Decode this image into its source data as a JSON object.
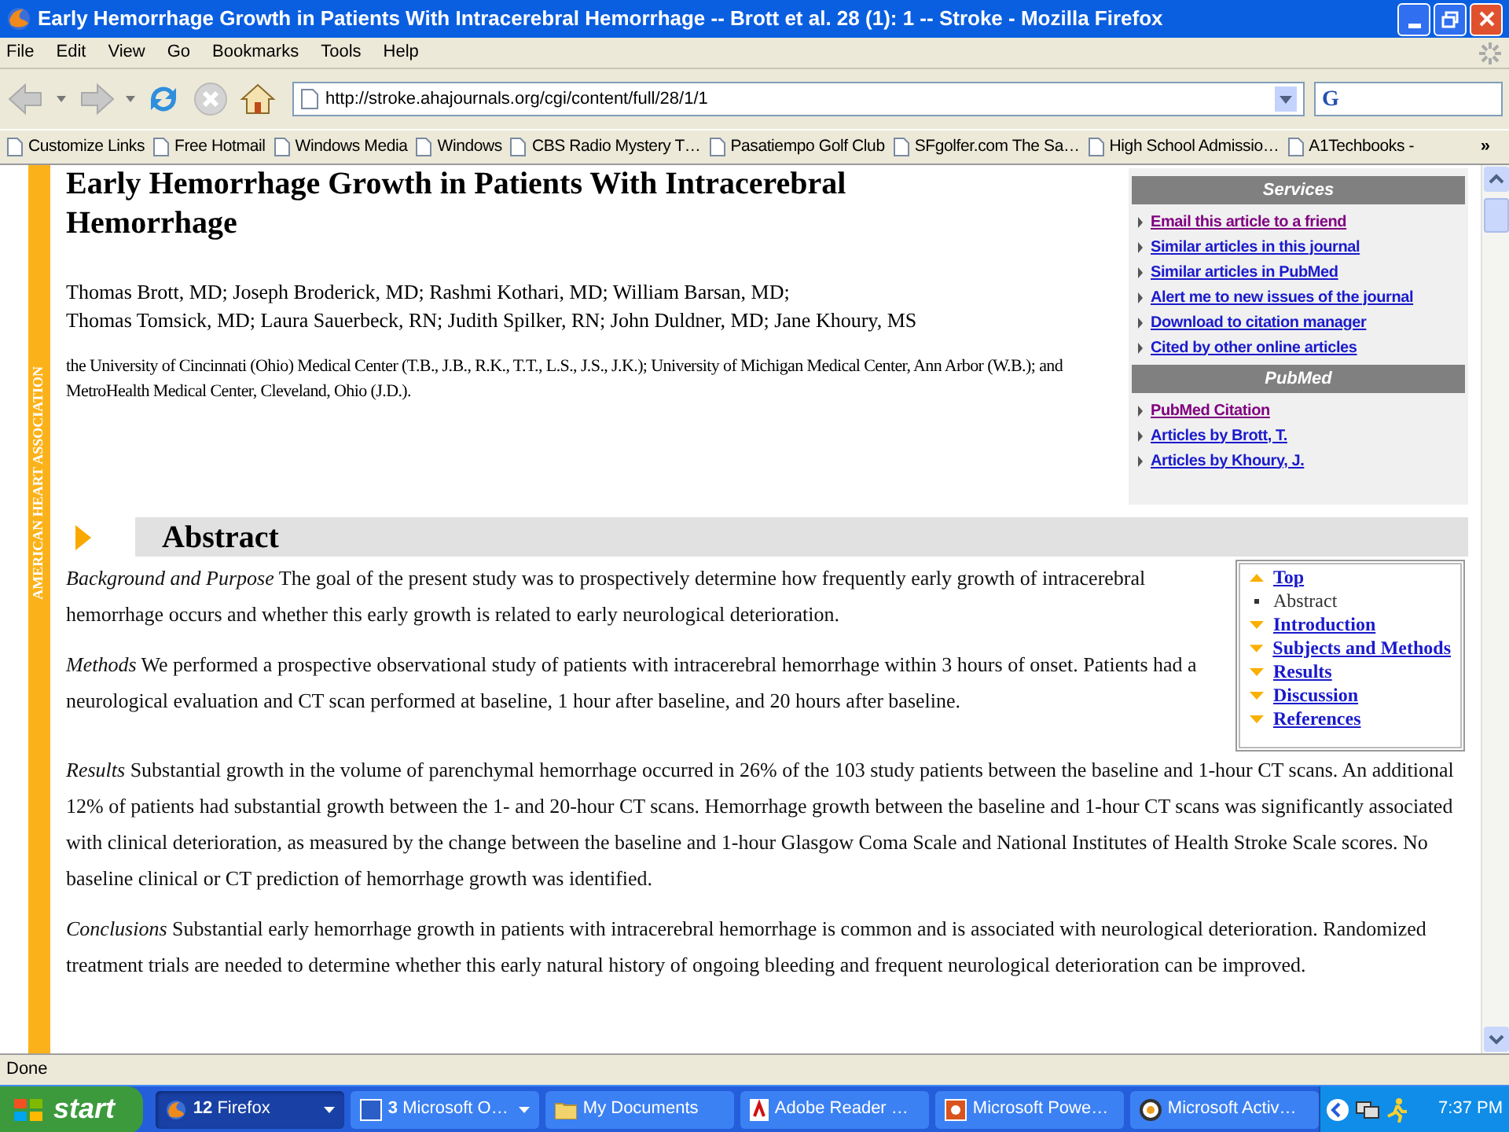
{
  "window": {
    "title": "Early Hemorrhage Growth in Patients With Intracerebral Hemorrhage -- Brott et al. 28 (1): 1 -- Stroke - Mozilla Firefox"
  },
  "menu": [
    "File",
    "Edit",
    "View",
    "Go",
    "Bookmarks",
    "Tools",
    "Help"
  ],
  "toolbar": {
    "url": "http://stroke.ahajournals.org/cgi/content/full/28/1/1",
    "search_logo": "G"
  },
  "bookmarks": [
    "Customize Links",
    "Free Hotmail",
    "Windows Media",
    "Windows",
    "CBS Radio Mystery T…",
    "Pasatiempo Golf Club",
    "SFgolfer.com The Sa…",
    "High School Admissio…",
    "A1Techbooks -"
  ],
  "bookmarks_more": "»",
  "article": {
    "sidebar_label": "AMERICAN HEART ASSOCIATION",
    "title": "Early Hemorrhage Growth in Patients With Intracerebral Hemorrhage",
    "authors": [
      "Thomas Brott, MD; Joseph Broderick, MD; Rashmi Kothari, MD; William Barsan, MD;",
      "Thomas Tomsick, MD; Laura Sauerbeck, RN; Judith Spilker, RN; John Duldner, MD; Jane Khoury, MS"
    ],
    "affiliation": "the University of Cincinnati (Ohio) Medical Center (T.B., J.B., R.K., T.T., L.S., J.S., J.K.); University of Michigan Medical Center, Ann Arbor (W.B.); and MetroHealth Medical Center, Cleveland, Ohio (J.D.).",
    "section_heading": "Abstract",
    "paragraphs": [
      "*Background and Purpose* The goal of the present study was to prospectively determine how frequently early growth of intracerebral hemorrhage occurs and whether this early growth is related to early neurological deterioration.",
      "*Methods* We performed a prospective observational study of patients with intracerebral hemorrhage within 3 hours of onset. Patients had a neurological evaluation and CT scan performed at baseline, 1 hour after baseline, and 20 hours after baseline.",
      "*Results* Substantial growth in the volume of parenchymal hemorrhage occurred in 26% of the 103 study patients between the baseline and 1-hour CT scans. An additional 12% of patients had substantial growth between the 1- and 20-hour CT scans. Hemorrhage growth between the baseline and 1-hour CT scans was significantly associated with clinical deterioration, as measured by the change between the baseline and 1-hour Glasgow Coma Scale and National Institutes of Health Stroke Scale scores. No baseline clinical or CT prediction of hemorrhage growth was identified.",
      "*Conclusions* Substantial early hemorrhage growth in patients with intracerebral hemorrhage is common and is associated with neurological deterioration. Randomized treatment trials are needed to determine whether this early natural history of ongoing bleeding and frequent neurological deterioration can be improved."
    ]
  },
  "services": {
    "heading": "Services",
    "links": [
      {
        "label": "Email this article to a friend",
        "visited": true
      },
      {
        "label": "Similar articles in this journal",
        "visited": false
      },
      {
        "label": "Similar articles in PubMed",
        "visited": false
      },
      {
        "label": "Alert me to new issues of the journal",
        "visited": false
      },
      {
        "label": "Download to citation manager",
        "visited": false
      },
      {
        "label": "Cited by other online articles",
        "visited": false
      }
    ]
  },
  "pubmed": {
    "heading": "PubMed",
    "links": [
      {
        "label": "PubMed Citation",
        "visited": true
      },
      {
        "label": "Articles by Brott, T.",
        "visited": false
      },
      {
        "label": "Articles by Khoury, J.",
        "visited": false
      }
    ]
  },
  "toc": [
    {
      "label": "Top",
      "kind": "up"
    },
    {
      "label": "Abstract",
      "kind": "current"
    },
    {
      "label": "Introduction",
      "kind": "down"
    },
    {
      "label": "Subjects and Methods",
      "kind": "down"
    },
    {
      "label": "Results",
      "kind": "down"
    },
    {
      "label": "Discussion",
      "kind": "down"
    },
    {
      "label": "References",
      "kind": "down"
    }
  ],
  "status_bar": "Done",
  "taskbar": {
    "start": "start",
    "tasks": [
      {
        "label": "**12** Firefox",
        "selected": true,
        "group": true
      },
      {
        "label": "**3** Microsoft O…",
        "selected": false,
        "group": true
      },
      {
        "label": "My Documents",
        "selected": false,
        "group": false
      },
      {
        "label": "Adobe Reader …",
        "selected": false,
        "group": false
      },
      {
        "label": "Microsoft Powe…",
        "selected": false,
        "group": false
      },
      {
        "label": "Microsoft Activ…",
        "selected": false,
        "group": false
      }
    ],
    "clock": "7:37 PM"
  }
}
